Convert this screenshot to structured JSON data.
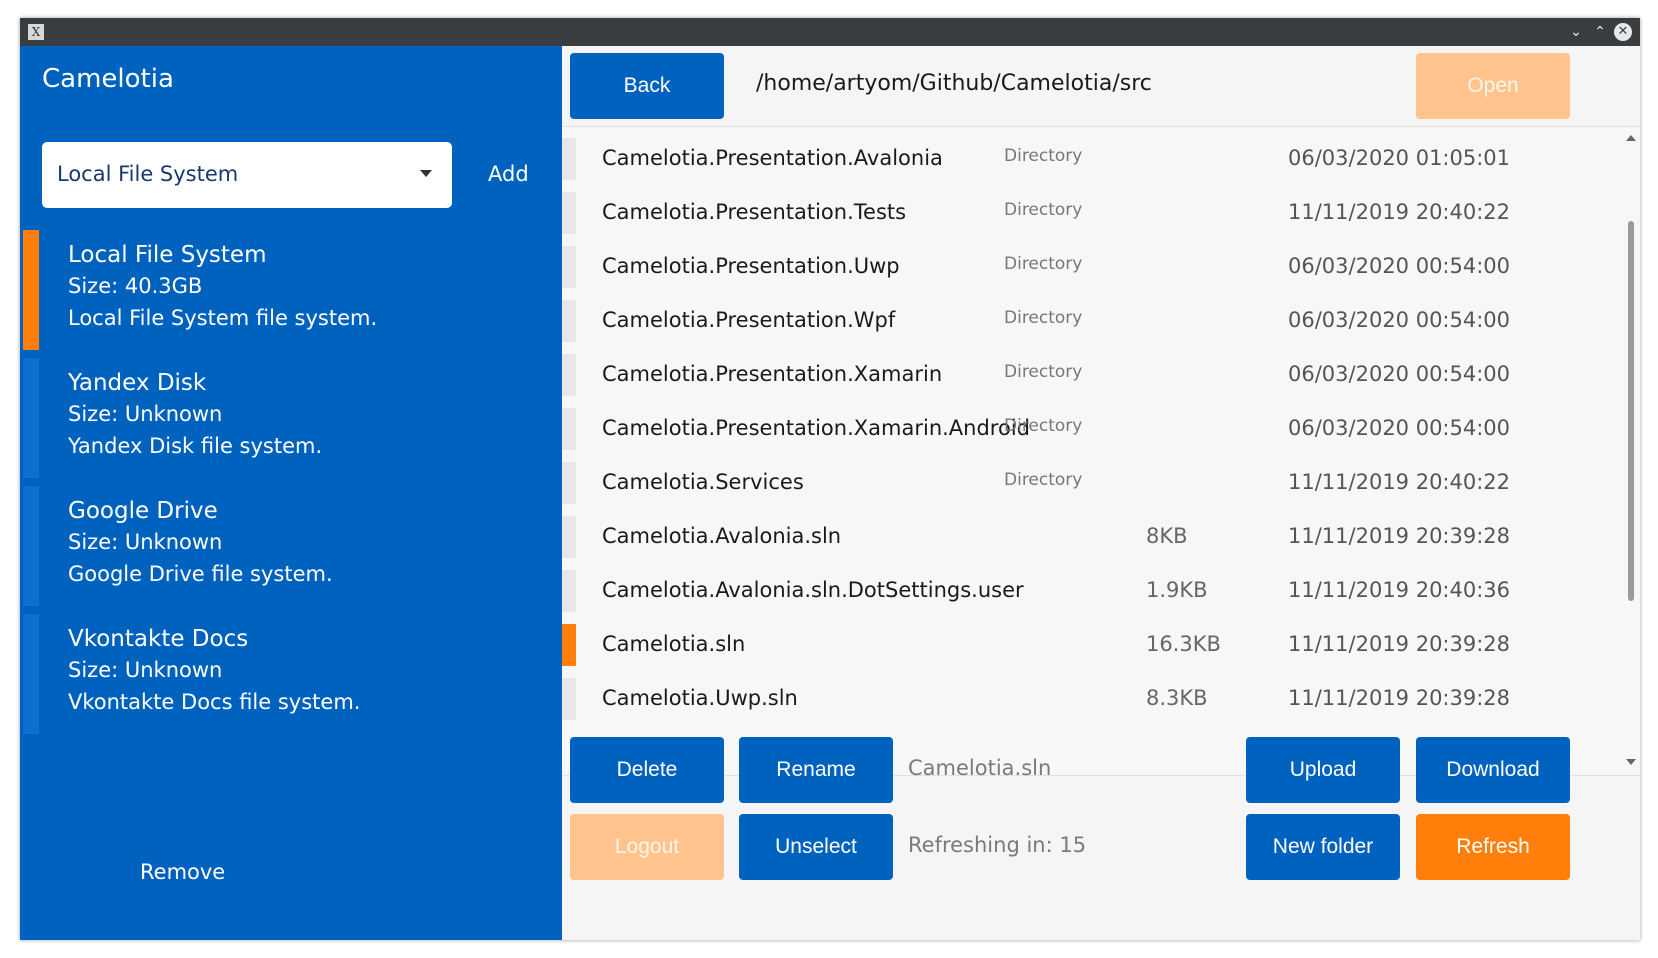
{
  "window": {
    "icon_glyph": "X",
    "controls": {
      "minimize": "⌄",
      "maximize": "⌃",
      "close": "✕"
    }
  },
  "sidebar": {
    "title": "Camelotia",
    "combo_value": "Local File System",
    "add_label": "Add",
    "remove_label": "Remove",
    "items": [
      {
        "name": "Local File System",
        "size": "Size: 40.3GB",
        "description": "Local File System file system.",
        "active": true
      },
      {
        "name": "Yandex Disk",
        "size": "Size: Unknown",
        "description": "Yandex Disk file system.",
        "active": false
      },
      {
        "name": "Google Drive",
        "size": "Size: Unknown",
        "description": "Google Drive file system.",
        "active": false
      },
      {
        "name": "Vkontakte Docs",
        "size": "Size: Unknown",
        "description": "Vkontakte Docs file system.",
        "active": false
      }
    ]
  },
  "toolbar": {
    "back_label": "Back",
    "path": "/home/artyom/Github/Camelotia/src",
    "open_label": "Open"
  },
  "files": [
    {
      "name": "Camelotia.Presentation.Avalonia",
      "type": "Directory",
      "size": "",
      "date": "06/03/2020 01:05:01",
      "selected": false
    },
    {
      "name": "Camelotia.Presentation.Tests",
      "type": "Directory",
      "size": "",
      "date": "11/11/2019 20:40:22",
      "selected": false
    },
    {
      "name": "Camelotia.Presentation.Uwp",
      "type": "Directory",
      "size": "",
      "date": "06/03/2020 00:54:00",
      "selected": false
    },
    {
      "name": "Camelotia.Presentation.Wpf",
      "type": "Directory",
      "size": "",
      "date": "06/03/2020 00:54:00",
      "selected": false
    },
    {
      "name": "Camelotia.Presentation.Xamarin",
      "type": "Directory",
      "size": "",
      "date": "06/03/2020 00:54:00",
      "selected": false
    },
    {
      "name": "Camelotia.Presentation.Xamarin.Android",
      "type": "Directory",
      "size": "",
      "date": "06/03/2020 00:54:00",
      "selected": false
    },
    {
      "name": "Camelotia.Services",
      "type": "Directory",
      "size": "",
      "date": "11/11/2019 20:40:22",
      "selected": false
    },
    {
      "name": "Camelotia.Avalonia.sln",
      "type": "",
      "size": "8KB",
      "date": "11/11/2019 20:39:28",
      "selected": false
    },
    {
      "name": "Camelotia.Avalonia.sln.DotSettings.user",
      "type": "",
      "size": "1.9KB",
      "date": "11/11/2019 20:40:36",
      "selected": false
    },
    {
      "name": "Camelotia.sln",
      "type": "",
      "size": "16.3KB",
      "date": "11/11/2019 20:39:28",
      "selected": true
    },
    {
      "name": "Camelotia.Uwp.sln",
      "type": "",
      "size": "8.3KB",
      "date": "11/11/2019 20:39:28",
      "selected": false
    }
  ],
  "actions": {
    "delete_label": "Delete",
    "rename_label": "Rename",
    "selected_file": "Camelotia.sln",
    "upload_label": "Upload",
    "download_label": "Download",
    "logout_label": "Logout",
    "unselect_label": "Unselect",
    "refresh_status": "Refreshing in: 15",
    "new_folder_label": "New folder",
    "refresh_label": "Refresh"
  },
  "colors": {
    "sidebar_bg": "#0062bf",
    "accent_orange": "#ff7f0a",
    "disabled_orange": "#ffc48d",
    "button_blue": "#0062bf"
  }
}
